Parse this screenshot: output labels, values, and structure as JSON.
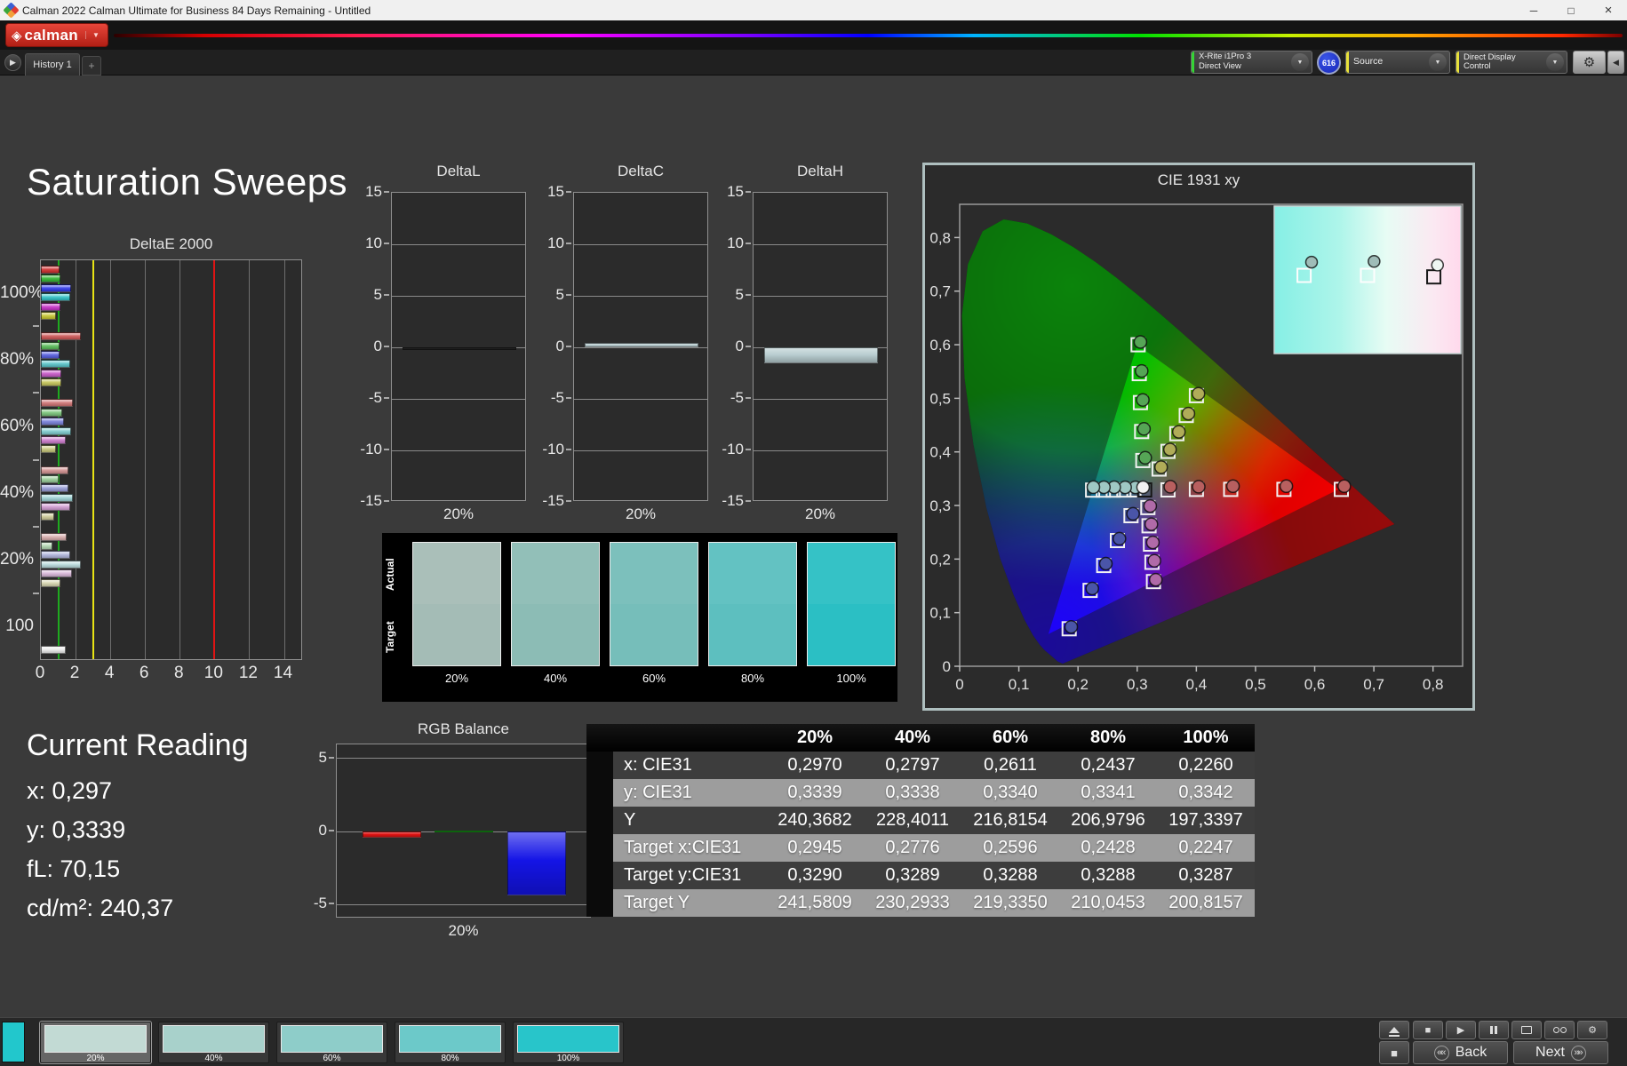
{
  "window": {
    "title": "Calman 2022 Calman Ultimate for Business 84 Days Remaining  - Untitled"
  },
  "icons": {
    "dropdown": "▼",
    "minimize": "─",
    "maximize": "□",
    "close": "×",
    "tab_expand": "▶",
    "add_tab": "+",
    "calman_gem": "◈",
    "play": "▶",
    "stop": "■",
    "pattern_square": "■",
    "gear": "⚙",
    "collapse_right": "◀",
    "back_chevron": "««",
    "next_chevron": "»»"
  },
  "menubar": {
    "logo_label": "calman"
  },
  "tabs": {
    "history_tab": "History 1"
  },
  "toolbar": {
    "meter_line1": "X-Rite i1Pro 3",
    "meter_line2": "Direct View",
    "badge": "616",
    "source_label": "Source",
    "display_label": "Direct Display Control",
    "accent_green": "#35d435",
    "accent_yellow": "#e8e13a"
  },
  "page": {
    "title": "Saturation Sweeps"
  },
  "current_reading": {
    "title": "Current Reading",
    "lines": [
      "x: 0,297",
      "y: 0,3339",
      "fL: 70,15",
      "cd/m²: 240,37"
    ]
  },
  "swatch_panel": {
    "row_labels": [
      "Actual",
      "Target"
    ],
    "labels": [
      "20%",
      "40%",
      "60%",
      "80%",
      "100%"
    ],
    "actual_colors": [
      "#aabfb9",
      "#92bfb8",
      "#7cc0bc",
      "#63c2c2",
      "#35c2c6"
    ],
    "target_colors": [
      "#a4bcb6",
      "#8cbcb5",
      "#76beba",
      "#5dbfbf",
      "#2bbfc4"
    ]
  },
  "bottom_bar": {
    "pattern_color": "#22c7cc",
    "swatches": [
      {
        "label": "20%",
        "color": "#c2dad4",
        "selected": true
      },
      {
        "label": "40%",
        "color": "#a8d1cb",
        "selected": false
      },
      {
        "label": "60%",
        "color": "#8ecdc9",
        "selected": false
      },
      {
        "label": "80%",
        "color": "#6cc9c9",
        "selected": false
      },
      {
        "label": "100%",
        "color": "#28c5ca",
        "selected": false
      }
    ],
    "tools": [
      {
        "name": "stop",
        "glyph": "■"
      },
      {
        "name": "play",
        "glyph": "▶"
      },
      {
        "name": "pause",
        "glyph": ""
      },
      {
        "name": "pattern-window",
        "glyph": ""
      },
      {
        "name": "glasses",
        "glyph": ""
      },
      {
        "name": "settings",
        "glyph": "⚙"
      }
    ],
    "back_label": "Back",
    "next_label": "Next"
  },
  "chart_data": [
    {
      "id": "deltaE2000",
      "type": "bar",
      "orientation": "horizontal",
      "title": "DeltaE 2000",
      "xlim": [
        0,
        15.1
      ],
      "xticks": [
        0,
        2,
        4,
        6,
        8,
        10,
        12,
        14
      ],
      "reference_lines": [
        {
          "value": 1,
          "color": "#1faa1f"
        },
        {
          "value": 3,
          "color": "#e8e414"
        },
        {
          "value": 10,
          "color": "#e01414"
        }
      ],
      "groups": [
        {
          "label": "100%",
          "values": [
            1.05,
            1.15,
            1.75,
            1.7,
            1.15,
            0.85
          ],
          "colors": [
            "#cf2b2b",
            "#2eb42e",
            "#2d35e8",
            "#2cc0c6",
            "#c72fc7",
            "#c6c62e"
          ]
        },
        {
          "label": "80%",
          "values": [
            2.3,
            1.1,
            1.1,
            1.7,
            1.2,
            1.2
          ],
          "colors": [
            "#cd5353",
            "#57bd57",
            "#545cdf",
            "#57c4c9",
            "#c757c7",
            "#c3c357"
          ]
        },
        {
          "label": "60%",
          "values": [
            1.85,
            1.25,
            1.35,
            1.75,
            1.45,
            0.85
          ],
          "colors": [
            "#cf7272",
            "#79c479",
            "#767dd9",
            "#7ccbce",
            "#cc7acc",
            "#c6c67a"
          ]
        },
        {
          "label": "40%",
          "values": [
            1.6,
            1.0,
            1.6,
            1.85,
            1.7,
            0.75
          ],
          "colors": [
            "#d29090",
            "#97cd97",
            "#959ad6",
            "#9cd2d4",
            "#d29cd2",
            "#cdcb97"
          ]
        },
        {
          "label": "20%",
          "values": [
            1.5,
            0.65,
            1.7,
            2.3,
            1.8,
            1.15
          ],
          "colors": [
            "#d8acac",
            "#b2d8b2",
            "#b0b4dc",
            "#b8dadc",
            "#d8b6d8",
            "#d6d4ae"
          ]
        },
        {
          "label": "100",
          "values": [
            1.45
          ],
          "colors": [
            "#ececec"
          ]
        }
      ]
    },
    {
      "id": "deltaL",
      "type": "bar",
      "title": "DeltaL",
      "ylim": [
        -15,
        15
      ],
      "yticks": [
        15,
        10,
        5,
        0,
        -5,
        -10,
        -15
      ],
      "categories": [
        "20%"
      ],
      "values": [
        -0.25
      ],
      "colors": [
        "#0c0c0c"
      ]
    },
    {
      "id": "deltaC",
      "type": "bar",
      "title": "DeltaC",
      "ylim": [
        -15,
        15
      ],
      "yticks": [
        15,
        10,
        5,
        0,
        -5,
        -10,
        -15
      ],
      "categories": [
        "20%"
      ],
      "values": [
        0.45
      ],
      "colors": [
        "#b9ced1"
      ]
    },
    {
      "id": "deltaH",
      "type": "bar",
      "title": "DeltaH",
      "ylim": [
        -15,
        15
      ],
      "yticks": [
        15,
        10,
        5,
        0,
        -5,
        -10,
        -15
      ],
      "categories": [
        "20%"
      ],
      "values": [
        -1.55
      ],
      "colors": [
        "#b9ced1"
      ]
    },
    {
      "id": "rgbBalance",
      "type": "bar",
      "title": "RGB Balance",
      "ylim": [
        -5.95,
        5.95
      ],
      "yticks": [
        5,
        0,
        -5
      ],
      "categories": [
        "20%"
      ],
      "series": [
        {
          "name": "Red",
          "value": -0.4,
          "color": "#e11414"
        },
        {
          "name": "Green",
          "value": 0.05,
          "color": "#18b418"
        },
        {
          "name": "Blue",
          "value": -4.35,
          "color": "#1414e6"
        }
      ]
    },
    {
      "id": "cie",
      "type": "scatter",
      "title": "CIE 1931 xy",
      "xlim": [
        0,
        0.85
      ],
      "ylim": [
        0,
        0.862
      ],
      "xtick_labels": [
        "0",
        "0,1",
        "0,2",
        "0,3",
        "0,4",
        "0,5",
        "0,6",
        "0,7",
        "0,8"
      ],
      "ytick_labels": [
        "0",
        "0,1",
        "0,2",
        "0,3",
        "0,4",
        "0,5",
        "0,6",
        "0,7",
        "0,8"
      ],
      "gamut_triangle": [
        [
          0.64,
          0.33
        ],
        [
          0.3,
          0.6
        ],
        [
          0.15,
          0.06
        ]
      ],
      "white_point": {
        "target": [
          0.3127,
          0.329
        ],
        "measured": [
          0.31,
          0.334
        ],
        "color": "#f2f2f2"
      },
      "sweeps": [
        {
          "name": "red",
          "point_color": "#b85f5f",
          "targets": [
            [
              0.352,
              0.329
            ],
            [
              0.4,
              0.33
            ],
            [
              0.458,
              0.33
            ],
            [
              0.548,
              0.33
            ],
            [
              0.645,
              0.33
            ]
          ],
          "measured": [
            [
              0.356,
              0.335
            ],
            [
              0.404,
              0.335
            ],
            [
              0.462,
              0.336
            ],
            [
              0.552,
              0.336
            ],
            [
              0.65,
              0.336
            ]
          ]
        },
        {
          "name": "green",
          "point_color": "#56a556",
          "targets": [
            [
              0.3095,
              0.384
            ],
            [
              0.3075,
              0.438
            ],
            [
              0.3055,
              0.492
            ],
            [
              0.3035,
              0.546
            ],
            [
              0.3015,
              0.6
            ]
          ],
          "measured": [
            [
              0.3135,
              0.389
            ],
            [
              0.3115,
              0.443
            ],
            [
              0.3095,
              0.497
            ],
            [
              0.3075,
              0.551
            ],
            [
              0.3055,
              0.605
            ]
          ]
        },
        {
          "name": "blue",
          "point_color": "#4a55a8",
          "targets": [
            [
              0.2895,
              0.281
            ],
            [
              0.2665,
              0.2345
            ],
            [
              0.2435,
              0.188
            ],
            [
              0.2205,
              0.1415
            ],
            [
              0.185,
              0.07
            ]
          ],
          "measured": [
            [
              0.293,
              0.2845
            ],
            [
              0.27,
              0.238
            ],
            [
              0.247,
              0.1915
            ],
            [
              0.224,
              0.145
            ],
            [
              0.1885,
              0.0735
            ]
          ]
        },
        {
          "name": "cyan",
          "point_color": "#9fc8c4",
          "targets": [
            [
              0.2945,
              0.329
            ],
            [
              0.2776,
              0.3289
            ],
            [
              0.2596,
              0.3288
            ],
            [
              0.2428,
              0.3288
            ],
            [
              0.2247,
              0.3287
            ]
          ],
          "measured": [
            [
              0.297,
              0.3339
            ],
            [
              0.2797,
              0.3338
            ],
            [
              0.2611,
              0.334
            ],
            [
              0.2437,
              0.3341
            ],
            [
              0.226,
              0.3342
            ]
          ]
        },
        {
          "name": "magenta",
          "point_color": "#b06aa8",
          "targets": [
            [
              0.318,
              0.296
            ],
            [
              0.32,
              0.262
            ],
            [
              0.3225,
              0.228
            ],
            [
              0.325,
              0.194
            ],
            [
              0.3275,
              0.158
            ]
          ],
          "measured": [
            [
              0.322,
              0.299
            ],
            [
              0.324,
              0.265
            ],
            [
              0.3265,
              0.231
            ],
            [
              0.329,
              0.197
            ],
            [
              0.3315,
              0.1615
            ]
          ]
        },
        {
          "name": "yellow",
          "point_color": "#b0ac58",
          "targets": [
            [
              0.337,
              0.368
            ],
            [
              0.352,
              0.401
            ],
            [
              0.367,
              0.434
            ],
            [
              0.383,
              0.468
            ],
            [
              0.4,
              0.505
            ]
          ],
          "measured": [
            [
              0.3405,
              0.3715
            ],
            [
              0.3555,
              0.4045
            ],
            [
              0.3705,
              0.4375
            ],
            [
              0.3865,
              0.4715
            ],
            [
              0.4035,
              0.5085
            ]
          ]
        }
      ],
      "inset": {
        "squares": [
          [
            0.16,
            0.47
          ],
          [
            0.5,
            0.47
          ]
        ],
        "circles": [
          [
            0.2,
            0.38
          ],
          [
            0.535,
            0.375
          ]
        ],
        "black_square": [
          0.855,
          0.48
        ],
        "white_circle": [
          0.875,
          0.4
        ]
      }
    },
    {
      "id": "dataTable",
      "type": "table",
      "columns": [
        "",
        "20%",
        "40%",
        "60%",
        "80%",
        "100%"
      ],
      "rows": [
        {
          "label": "x: CIE31",
          "values": [
            "0,2970",
            "0,2797",
            "0,2611",
            "0,2437",
            "0,2260"
          ]
        },
        {
          "label": "y: CIE31",
          "values": [
            "0,3339",
            "0,3338",
            "0,3340",
            "0,3341",
            "0,3342"
          ]
        },
        {
          "label": "Y",
          "values": [
            "240,3682",
            "228,4011",
            "216,8154",
            "206,9796",
            "197,3397"
          ]
        },
        {
          "label": "Target x:CIE31",
          "values": [
            "0,2945",
            "0,2776",
            "0,2596",
            "0,2428",
            "0,2247"
          ]
        },
        {
          "label": "Target y:CIE31",
          "values": [
            "0,3290",
            "0,3289",
            "0,3288",
            "0,3288",
            "0,3287"
          ]
        },
        {
          "label": "Target Y",
          "values": [
            "241,5809",
            "230,2933",
            "219,3350",
            "210,0453",
            "200,8157"
          ]
        }
      ]
    }
  ]
}
